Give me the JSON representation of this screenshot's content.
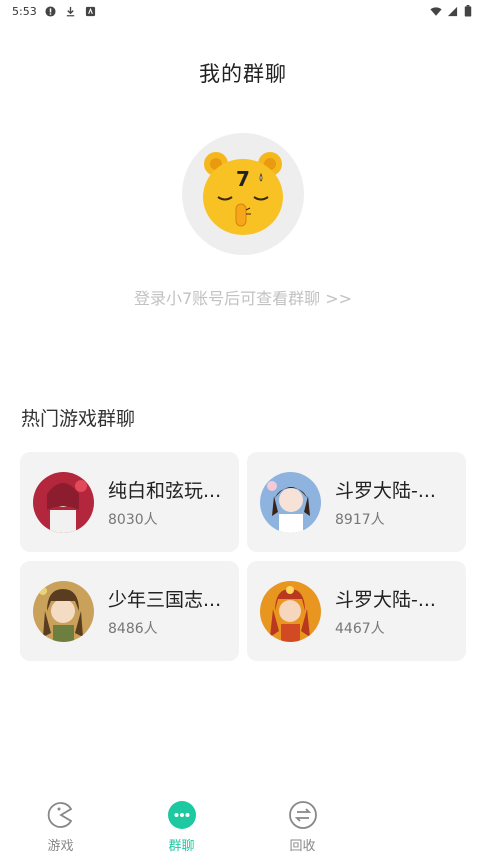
{
  "status_bar": {
    "time": "5:53",
    "icons": [
      "alert-icon",
      "download-icon",
      "app-icon",
      "wifi-icon",
      "signal-icon",
      "battery-icon"
    ]
  },
  "header": {
    "title": "我的群聊"
  },
  "empty_state": {
    "mascot": "mascot-icon",
    "login_hint": "登录小7账号后可查看群聊 >>"
  },
  "hot_section": {
    "title": "热门游戏群聊",
    "groups": [
      {
        "name": "纯白和弦玩...",
        "count": "8030人",
        "avatar_color": "#b3263b"
      },
      {
        "name": "斗罗大陆-...",
        "count": "8917人",
        "avatar_color": "#6f8fbf"
      },
      {
        "name": "少年三国志...",
        "count": "8486人",
        "avatar_color": "#a37b3f"
      },
      {
        "name": "斗罗大陆-...",
        "count": "4467人",
        "avatar_color": "#d7821e"
      }
    ]
  },
  "bottom_nav": {
    "items": [
      {
        "label": "游戏",
        "icon": "game-icon",
        "active": false
      },
      {
        "label": "群聊",
        "icon": "chat-icon",
        "active": true
      },
      {
        "label": "回收",
        "icon": "recycle-icon",
        "active": false
      }
    ],
    "accent": "#1ec9a2"
  }
}
